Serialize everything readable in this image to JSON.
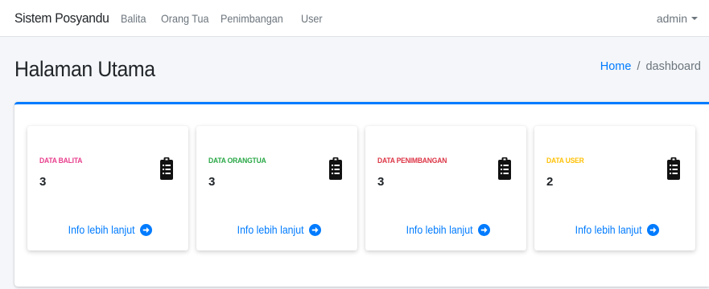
{
  "navbar": {
    "brand": "Sistem Posyandu",
    "links": [
      "Balita",
      "Orang Tua",
      "Penimbangan",
      "User"
    ],
    "user": "admin"
  },
  "header": {
    "title": "Halaman Utama",
    "breadcrumb": {
      "home": "Home",
      "separator": "/",
      "current": "dashboard"
    }
  },
  "boxes": [
    {
      "label": "DATA BALITA",
      "value": "3",
      "color": "#e83e8c",
      "link": "Info lebih lanjut",
      "icon": "clipboard-list-icon"
    },
    {
      "label": "DATA ORANGTUA",
      "value": "3",
      "color": "#28a745",
      "link": "Info lebih lanjut",
      "icon": "clipboard-list-icon"
    },
    {
      "label": "DATA PENIMBANGAN",
      "value": "3",
      "color": "#dc3545",
      "link": "Info lebih lanjut",
      "icon": "clipboard-list-icon"
    },
    {
      "label": "DATA USER",
      "value": "2",
      "color": "#ffc107",
      "link": "Info lebih lanjut",
      "icon": "clipboard-list-icon"
    }
  ],
  "colors": {
    "accent": "#007bff",
    "link": "#007bff"
  }
}
